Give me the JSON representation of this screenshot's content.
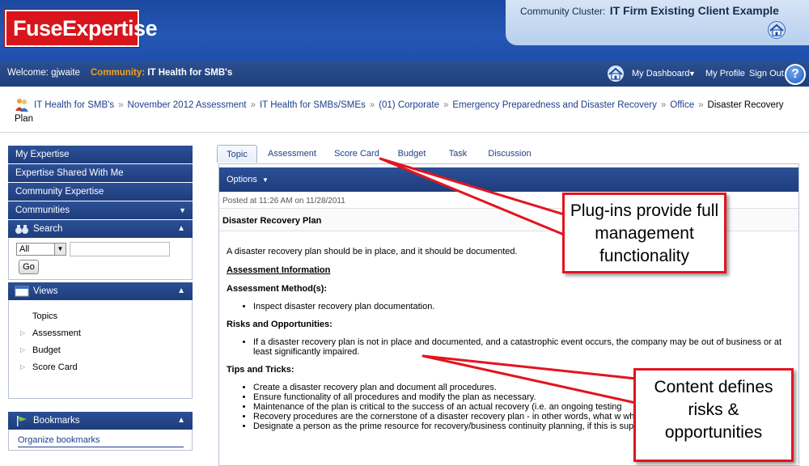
{
  "header": {
    "logo_text": "FuseExpertise",
    "cluster_label": "Community Cluster:",
    "cluster_name": "IT Firm Existing Client Example"
  },
  "welcome_bar": {
    "welcome_text": "Welcome: gjwaite",
    "community_label": "Community:",
    "community_name": "IT Health for SMB's",
    "links": [
      "My Dashboard",
      "My Profile",
      "Sign Out"
    ],
    "help_label": "?"
  },
  "breadcrumb": {
    "items": [
      "IT Health for SMB's",
      "November 2012 Assessment",
      "IT Health for SMBs/SMEs",
      "(01) Corporate",
      "Emergency Preparedness and Disaster Recovery",
      "Office"
    ],
    "current": "Disaster Recovery Plan",
    "separator": "»"
  },
  "sidebar": {
    "nav": [
      "My Expertise",
      "Expertise Shared With Me",
      "Community Expertise",
      "Communities"
    ],
    "search": {
      "title": "Search",
      "select_value": "All",
      "go_label": "Go"
    },
    "views": {
      "title": "Views",
      "items": [
        "Topics",
        "Assessment",
        "Budget",
        "Score Card"
      ]
    },
    "bookmarks": {
      "title": "Bookmarks",
      "link": "Organize bookmarks"
    }
  },
  "tabs": [
    "Topic",
    "Assessment",
    "Score Card",
    "Budget",
    "Task",
    "Discussion"
  ],
  "content": {
    "options_label": "Options",
    "posted": "Posted at 11:26 AM on 11/28/2011",
    "title": "Disaster Recovery Plan",
    "intro": "A disaster recovery plan should be in place, and it should be documented.",
    "assessment_info": "Assessment Information",
    "method_heading": "Assessment Method(s):",
    "method_items": [
      "Inspect disaster recovery plan documentation."
    ],
    "risks_heading": "Risks and Opportunities:",
    "risks_items": [
      "If a disaster recovery plan is not in place and documented, and a catastrophic event occurs, the company may be out of business or at least significantly impaired."
    ],
    "tips_heading": "Tips and Tricks:",
    "tips_items": [
      "Create a disaster recovery plan and document all procedures.",
      "Ensure functionality of all procedures and modify the plan as necessary.",
      "Maintenance of the plan is critical to the success of an actual recovery (i.e. an ongoing testing",
      "Recovery procedures are the cornerstone of a disaster recovery plan - in other words, what w whom?",
      "Designate a person as the prime resource for recovery/business continuity planning, if this is support this individual."
    ]
  },
  "callouts": {
    "plugins": "Plug-ins provide full management functionality",
    "content": "Content defines risks & opportunities"
  },
  "colors": {
    "brand_red": "#d8141c",
    "nav_blue": "#1e3d7c",
    "callout_border": "#e3141f",
    "community_label": "#f3a21b"
  }
}
